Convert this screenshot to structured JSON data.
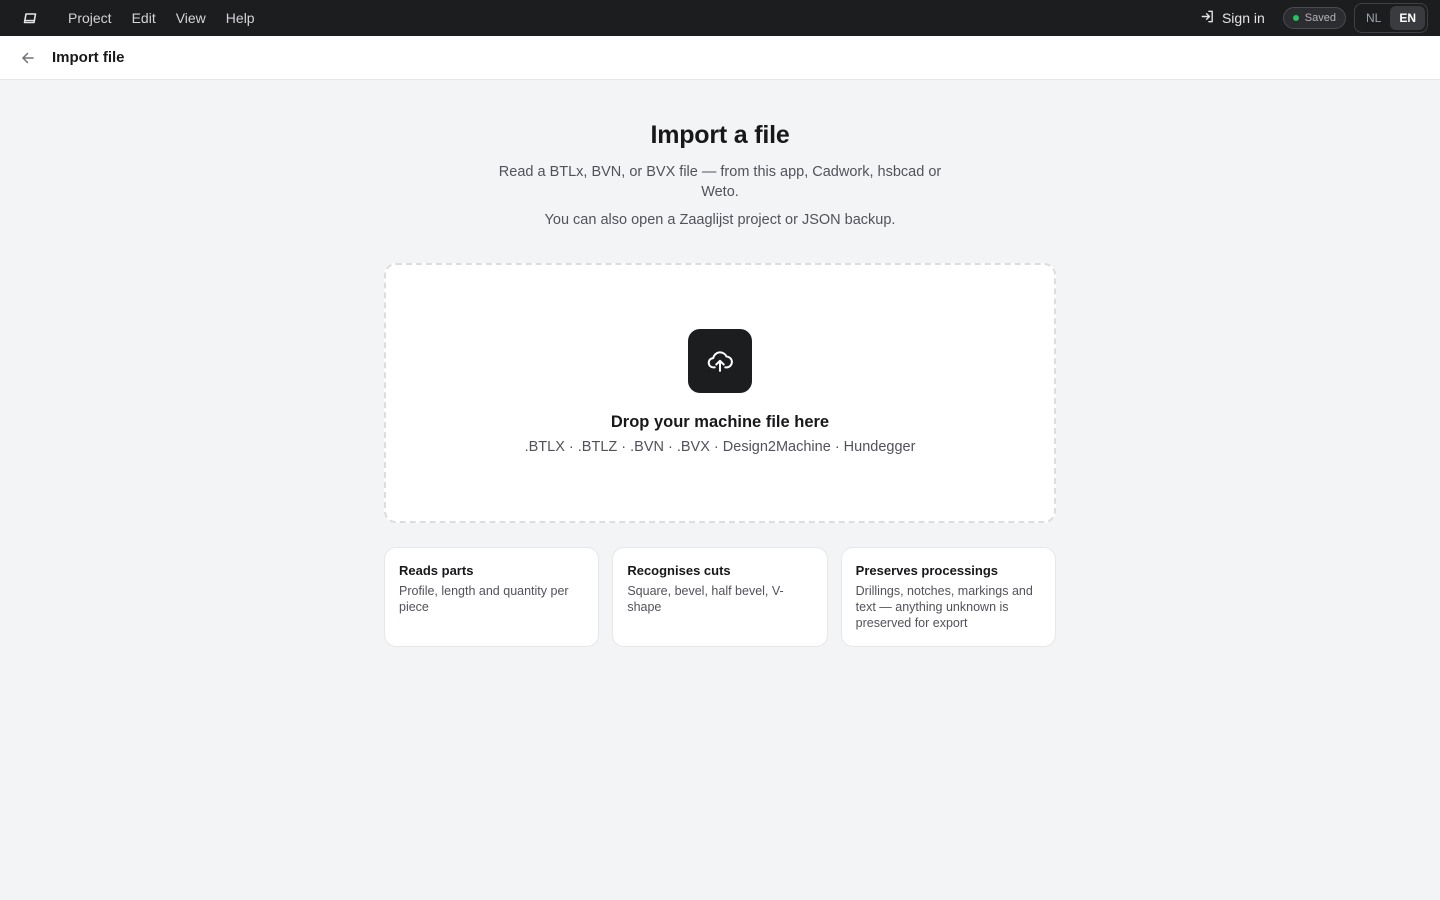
{
  "menubar": {
    "logo_icon": "app-logo-icon",
    "items": [
      {
        "label": "Project"
      },
      {
        "label": "Edit"
      },
      {
        "label": "View"
      },
      {
        "label": "Help"
      }
    ],
    "signin_label": "Sign in",
    "signin_icon": "sign-in-icon",
    "saved_label": "Saved",
    "saved_color": "#22c55e",
    "languages": [
      {
        "label": "NL",
        "active": false
      },
      {
        "label": "EN",
        "active": true
      }
    ]
  },
  "subheader": {
    "back_icon": "arrow-left-icon",
    "title": "Import file"
  },
  "main": {
    "title": "Import a file",
    "description": "Read a BTLx, BVN, or BVX file — from this app, Cadwork, hsbcad or Weto.",
    "description2": "You can also open a Zaaglijst project or JSON backup.",
    "dropzone": {
      "icon": "cloud-upload-icon",
      "title": "Drop your machine file here",
      "formats": ".BTLX · .BTLZ · .BVN · .BVX · Design2Machine · Hundegger"
    },
    "features": [
      {
        "title": "Reads parts",
        "text": "Profile, length and quantity per piece"
      },
      {
        "title": "Recognises cuts",
        "text": "Square, bevel, half bevel, V-shape"
      },
      {
        "title": "Preserves processings",
        "text": "Drillings, notches, markings and text — anything unknown is preserved for export"
      }
    ]
  },
  "colors": {
    "menubar_bg": "#1c1d1f",
    "page_bg": "#f3f4f6",
    "accent_dark": "#1c1d1f"
  }
}
